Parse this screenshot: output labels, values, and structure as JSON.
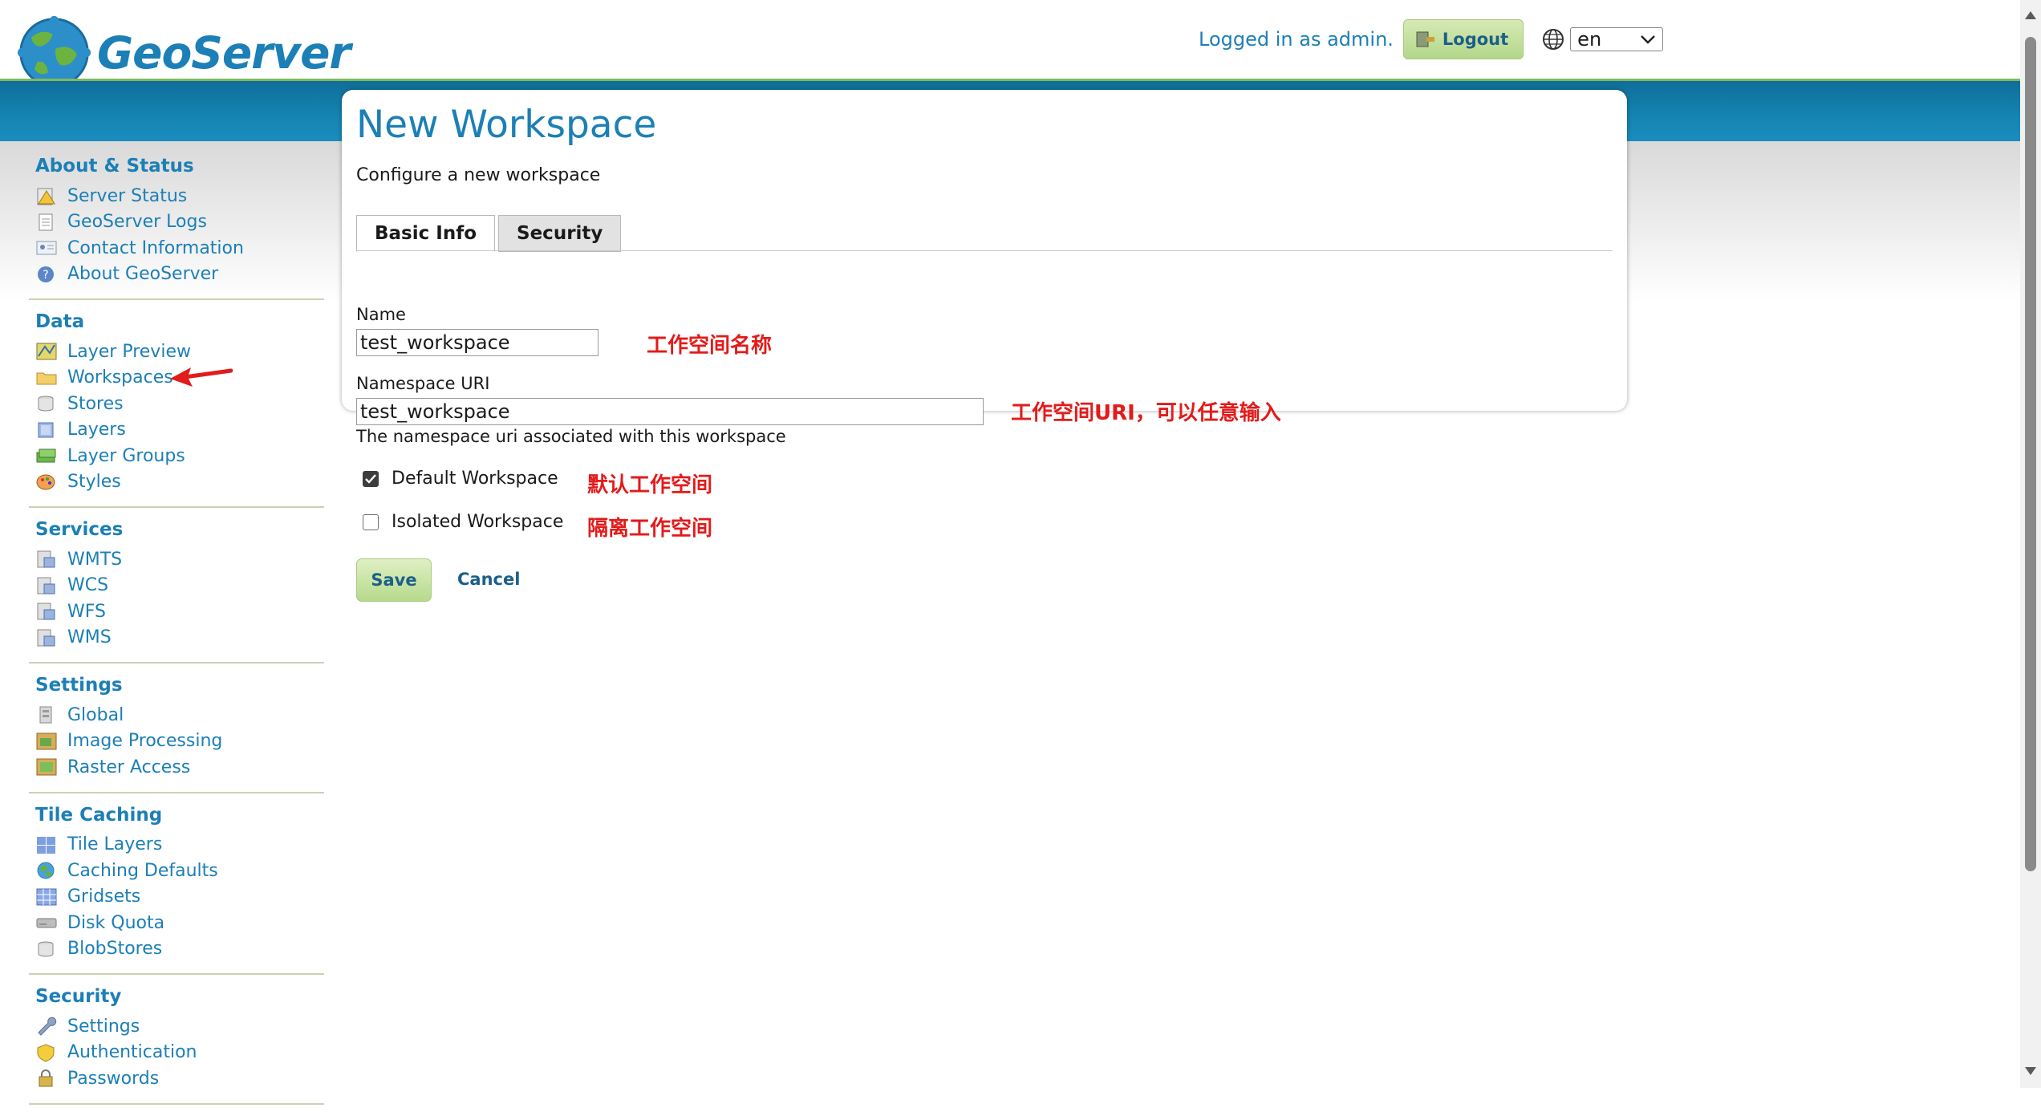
{
  "header": {
    "logo_text": "GeoServer",
    "logged_in_text": "Logged in as admin.",
    "logout_label": "Logout",
    "language_value": "en"
  },
  "sidebar": {
    "sections": [
      {
        "title": "About & Status",
        "items": [
          {
            "label": "Server Status",
            "icon": "server-status-icon"
          },
          {
            "label": "GeoServer Logs",
            "icon": "logs-icon"
          },
          {
            "label": "Contact Information",
            "icon": "contact-icon"
          },
          {
            "label": "About GeoServer",
            "icon": "help-icon"
          }
        ]
      },
      {
        "title": "Data",
        "items": [
          {
            "label": "Layer Preview",
            "icon": "layer-preview-icon"
          },
          {
            "label": "Workspaces",
            "icon": "folder-icon"
          },
          {
            "label": "Stores",
            "icon": "store-icon"
          },
          {
            "label": "Layers",
            "icon": "layers-icon"
          },
          {
            "label": "Layer Groups",
            "icon": "layer-groups-icon"
          },
          {
            "label": "Styles",
            "icon": "palette-icon"
          }
        ]
      },
      {
        "title": "Services",
        "items": [
          {
            "label": "WMTS",
            "icon": "service-icon"
          },
          {
            "label": "WCS",
            "icon": "service-icon"
          },
          {
            "label": "WFS",
            "icon": "service-icon"
          },
          {
            "label": "WMS",
            "icon": "service-icon"
          }
        ]
      },
      {
        "title": "Settings",
        "items": [
          {
            "label": "Global",
            "icon": "global-settings-icon"
          },
          {
            "label": "Image Processing",
            "icon": "image-processing-icon"
          },
          {
            "label": "Raster Access",
            "icon": "raster-access-icon"
          }
        ]
      },
      {
        "title": "Tile Caching",
        "items": [
          {
            "label": "Tile Layers",
            "icon": "tile-layers-icon"
          },
          {
            "label": "Caching Defaults",
            "icon": "globe-icon"
          },
          {
            "label": "Gridsets",
            "icon": "grid-icon"
          },
          {
            "label": "Disk Quota",
            "icon": "disk-icon"
          },
          {
            "label": "BlobStores",
            "icon": "store-icon"
          }
        ]
      },
      {
        "title": "Security",
        "items": [
          {
            "label": "Settings",
            "icon": "wrench-icon"
          },
          {
            "label": "Authentication",
            "icon": "shield-icon"
          },
          {
            "label": "Passwords",
            "icon": "lock-icon"
          }
        ]
      }
    ]
  },
  "main": {
    "title": "New Workspace",
    "subtitle": "Configure a new workspace",
    "tabs": [
      {
        "label": "Basic Info",
        "active": true
      },
      {
        "label": "Security",
        "active": false
      }
    ],
    "name_label": "Name",
    "name_value": "test_workspace",
    "name_annotation": "工作空间名称",
    "uri_label": "Namespace URI",
    "uri_value": "test_workspace",
    "uri_annotation": "工作空间URI，可以任意输入",
    "uri_hint": "The namespace uri associated with this workspace",
    "default_label": "Default Workspace",
    "default_checked": true,
    "default_annotation": "默认工作空间",
    "isolated_label": "Isolated Workspace",
    "isolated_checked": false,
    "isolated_annotation": "隔离工作空间",
    "save_label": "Save",
    "cancel_label": "Cancel"
  },
  "colors": {
    "accent": "#1c7fb6",
    "annotation": "#e21b1b",
    "header_band": "#1585b4"
  }
}
